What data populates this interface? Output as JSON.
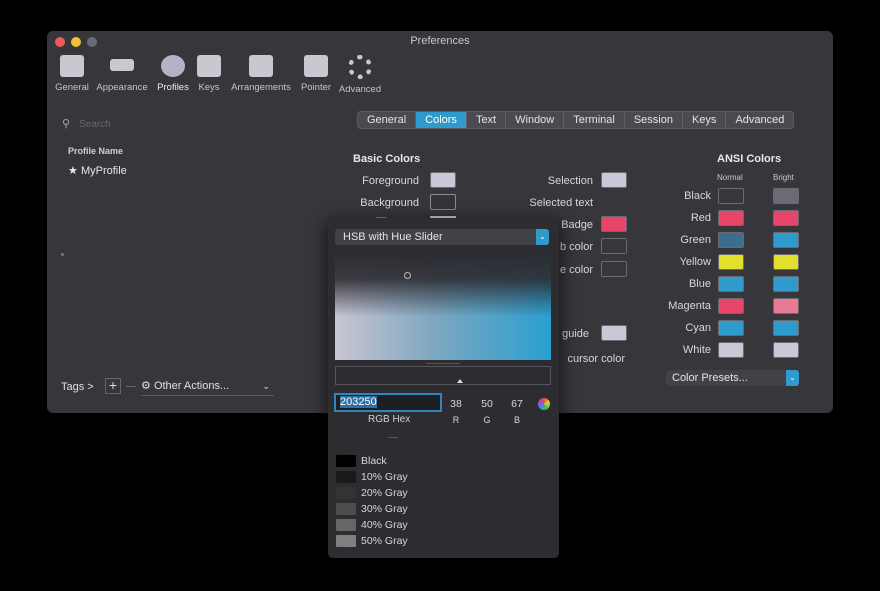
{
  "window": {
    "title": "Preferences"
  },
  "toolbar": [
    {
      "label": "General"
    },
    {
      "label": "Appearance"
    },
    {
      "label": "Profiles"
    },
    {
      "label": "Keys"
    },
    {
      "label": "Arrangements"
    },
    {
      "label": "Pointer"
    },
    {
      "label": "Advanced"
    }
  ],
  "sidebar": {
    "search_placeholder": "Search",
    "column_header": "Profile Name",
    "profiles": [
      {
        "name": "MyProfile"
      }
    ],
    "tags_label": "Tags >",
    "other_actions": "Other Actions..."
  },
  "tabs": [
    "General",
    "Colors",
    "Text",
    "Window",
    "Terminal",
    "Session",
    "Keys",
    "Advanced"
  ],
  "basic_colors": {
    "heading": "Basic Colors",
    "foreground": "Foreground",
    "foreground_color": "#c9c8d6",
    "background": "Background",
    "background_color": "#33333a",
    "selection": "Selection",
    "selection_color": "#c9c8d6",
    "selected_text": "Selected text",
    "badge": "Badge",
    "badge_color": "#e8456b",
    "tab_color_partial": "b color",
    "cursor_guide_partial": "e color",
    "guide": "guide",
    "cursor_color": "cursor color"
  },
  "ansi": {
    "heading": "ANSI Colors",
    "normal": "Normal",
    "bright": "Bright",
    "rows": [
      {
        "name": "Black",
        "normal": "#36363b",
        "bright": "#6b6b76"
      },
      {
        "name": "Red",
        "normal": "#e8456b",
        "bright": "#e8456b"
      },
      {
        "name": "Green",
        "normal": "#3b6e8e",
        "bright": "#2f9bcc"
      },
      {
        "name": "Yellow",
        "normal": "#e2e02c",
        "bright": "#e2e02c"
      },
      {
        "name": "Blue",
        "normal": "#2f9bcc",
        "bright": "#2f9bcc"
      },
      {
        "name": "Magenta",
        "normal": "#e8456b",
        "bright": "#e87a98"
      },
      {
        "name": "Cyan",
        "normal": "#2f9bcc",
        "bright": "#2f9bcc"
      },
      {
        "name": "White",
        "normal": "#c9c8d6",
        "bright": "#c9c8d6"
      }
    ],
    "presets": "Color Presets..."
  },
  "picker": {
    "mode": "HSB with Hue Slider",
    "hex": "203250",
    "hex_label": "RGB Hex",
    "r": "38",
    "g": "50",
    "b": "67",
    "r_label": "R",
    "g_label": "G",
    "b_label": "B",
    "swatches": [
      {
        "name": "Black",
        "color": "#000000"
      },
      {
        "name": "10% Gray",
        "color": "#1a1a1a"
      },
      {
        "name": "20% Gray",
        "color": "#333333"
      },
      {
        "name": "30% Gray",
        "color": "#4d4d4d"
      },
      {
        "name": "40% Gray",
        "color": "#666666"
      },
      {
        "name": "50% Gray",
        "color": "#808080"
      }
    ]
  }
}
